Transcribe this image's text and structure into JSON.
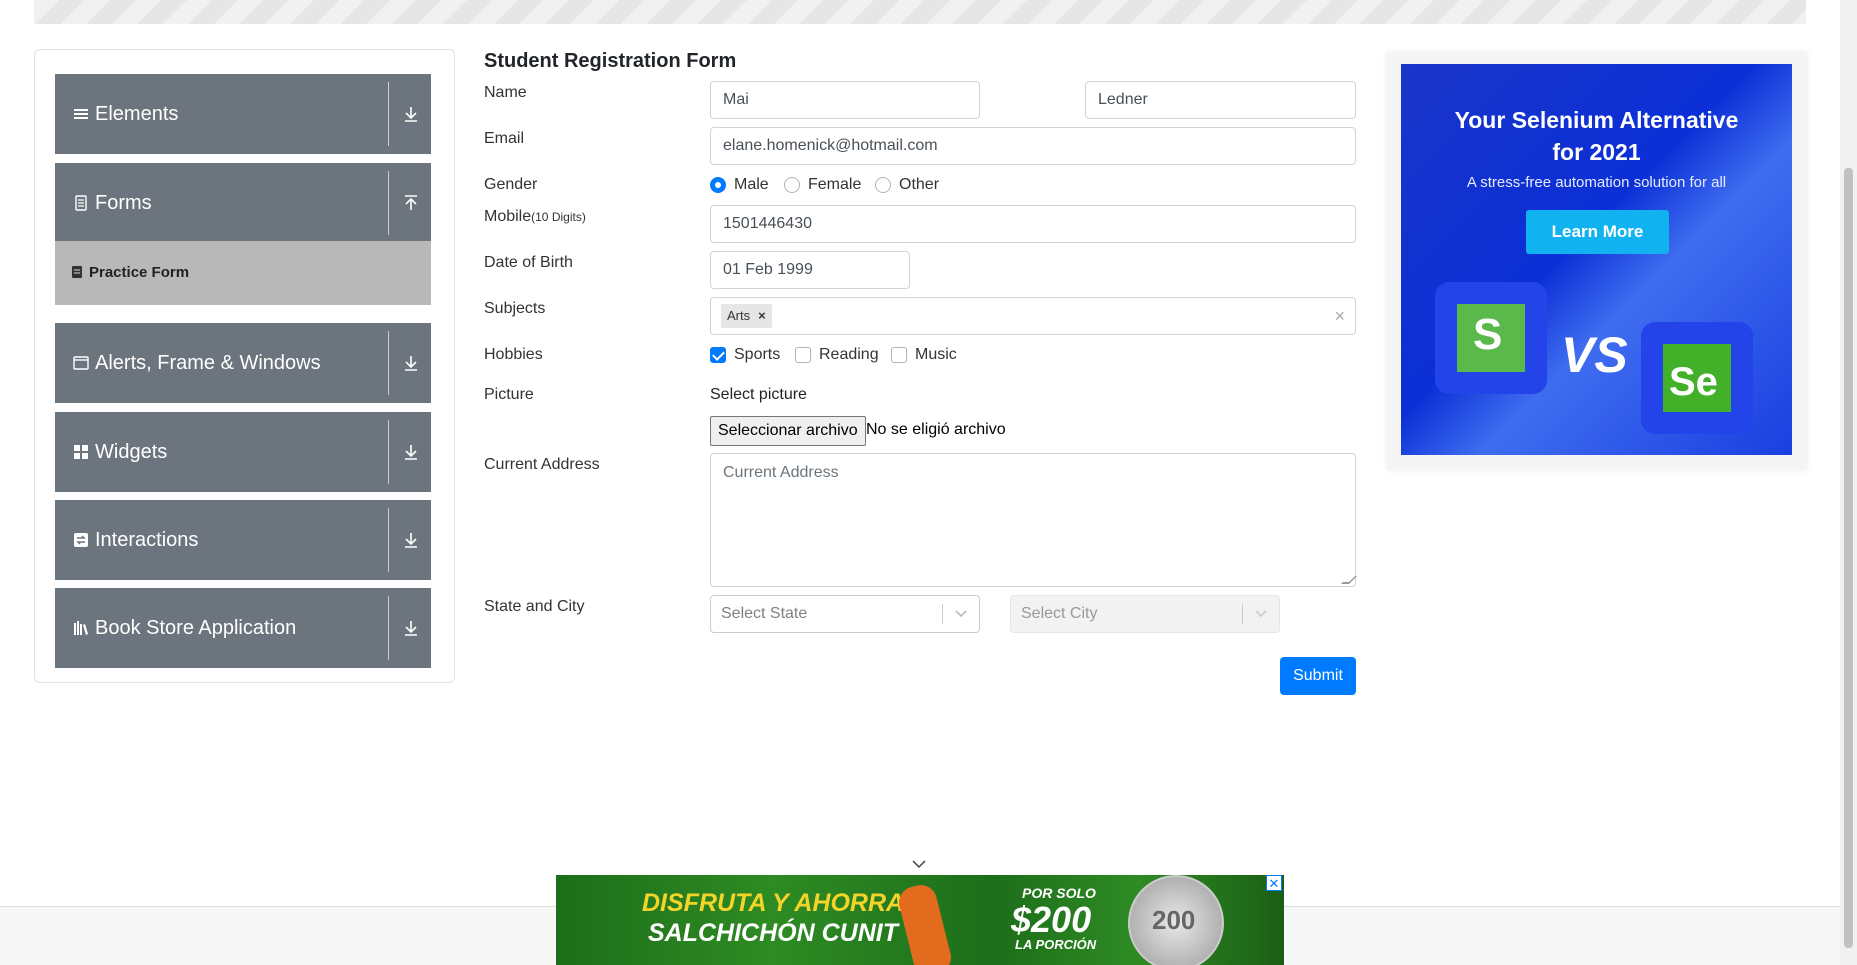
{
  "sidebar": {
    "groups": [
      {
        "label": "Elements",
        "icon": "hamburger-icon",
        "arrow": "download-icon"
      },
      {
        "label": "Forms",
        "icon": "document-icon",
        "arrow": "upload-icon"
      },
      {
        "label": "Alerts, Frame & Windows",
        "icon": "window-icon",
        "arrow": "download-icon"
      },
      {
        "label": "Widgets",
        "icon": "grid-icon",
        "arrow": "download-icon"
      },
      {
        "label": "Interactions",
        "icon": "interaction-icon",
        "arrow": "download-icon"
      },
      {
        "label": "Book Store Application",
        "icon": "books-icon",
        "arrow": "download-icon"
      }
    ],
    "active_item": {
      "label": "Practice Form",
      "icon": "form-icon"
    },
    "group_color": "#6c757d",
    "active_color": "#b8b8b8"
  },
  "form": {
    "title": "Student Registration Form",
    "name": {
      "label": "Name",
      "first": "Mai",
      "last": "Ledner"
    },
    "email": {
      "label": "Email",
      "value": "elane.homenick@hotmail.com"
    },
    "gender": {
      "label": "Gender",
      "options": [
        "Male",
        "Female",
        "Other"
      ],
      "selected": "Male"
    },
    "mobile": {
      "label": "Mobile",
      "hint": "(10 Digits)",
      "value": "1501446430"
    },
    "dob": {
      "label": "Date of Birth",
      "value": "01 Feb 1999"
    },
    "subjects": {
      "label": "Subjects",
      "chips": [
        "Arts"
      ]
    },
    "hobbies": {
      "label": "Hobbies",
      "options": [
        "Sports",
        "Reading",
        "Music"
      ],
      "checked": [
        "Sports"
      ]
    },
    "picture": {
      "label": "Picture",
      "prompt": "Select picture",
      "button": "Seleccionar archivo",
      "status": "No se eligió archivo"
    },
    "address": {
      "label": "Current Address",
      "placeholder": "Current Address"
    },
    "state_city": {
      "label": "State and City",
      "state_placeholder": "Select State",
      "city_placeholder": "Select City"
    },
    "submit": "Submit",
    "accent": "#007bff"
  },
  "ad": {
    "title_line1": "Your Selenium Alternative",
    "title_line2": "for 2021",
    "subtitle": "A stress-free automation solution for all",
    "button": "Learn More",
    "vs": "VS"
  },
  "banner": {
    "line1": "DISFRUTA Y AHORRA",
    "line2": "SALCHICHÓN CUNIT",
    "por_solo": "POR SOLO",
    "price": "$200",
    "portion": "LA PORCIÓN",
    "coin": "200"
  }
}
